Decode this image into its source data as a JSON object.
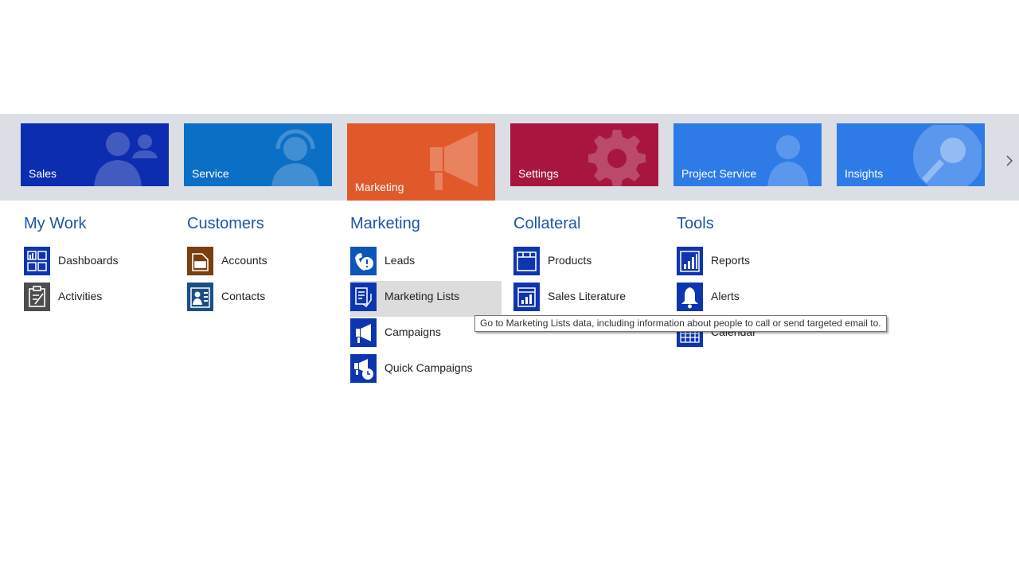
{
  "tiles": [
    {
      "label": "Sales",
      "color": "#0d2db0",
      "icon": "people-icon"
    },
    {
      "label": "Service",
      "color": "#0c6fc6",
      "icon": "headset-person-icon"
    },
    {
      "label": "Marketing",
      "color": "#e1582a",
      "icon": "megaphone-icon",
      "active": true
    },
    {
      "label": "Settings",
      "color": "#a8163f",
      "icon": "gear-icon"
    },
    {
      "label": "Project Service",
      "color": "#2e7be8",
      "icon": "person-icon"
    },
    {
      "label": "Insights",
      "color": "#2e7be8",
      "icon": "magnifier-icon"
    }
  ],
  "columns": [
    {
      "title": "My Work",
      "items": [
        {
          "label": "Dashboards",
          "icon": "dashboard-icon"
        },
        {
          "label": "Activities",
          "icon": "clipboard-icon"
        }
      ]
    },
    {
      "title": "Customers",
      "items": [
        {
          "label": "Accounts",
          "icon": "account-icon"
        },
        {
          "label": "Contacts",
          "icon": "contact-card-icon"
        }
      ]
    },
    {
      "title": "Marketing",
      "items": [
        {
          "label": "Leads",
          "icon": "phone-alert-icon"
        },
        {
          "label": "Marketing Lists",
          "icon": "list-icon",
          "hover": true
        },
        {
          "label": "Campaigns",
          "icon": "megaphone-icon"
        },
        {
          "label": "Quick Campaigns",
          "icon": "quick-campaign-icon"
        }
      ]
    },
    {
      "title": "Collateral",
      "items": [
        {
          "label": "Products",
          "icon": "box-icon"
        },
        {
          "label": "Sales Literature",
          "icon": "document-chart-icon"
        }
      ]
    },
    {
      "title": "Tools",
      "items": [
        {
          "label": "Reports",
          "icon": "report-icon"
        },
        {
          "label": "Alerts",
          "icon": "bell-icon"
        },
        {
          "label": "Calendar",
          "icon": "calendar-icon"
        }
      ]
    }
  ],
  "tooltip": "Go to Marketing Lists data, including information about people to call or send targeted email to.",
  "colors": {
    "heading": "#1e55a8",
    "icon_bg": "#0d35b0",
    "strip_bg": "#dcdee6",
    "hover_bg": "#dcdcdc"
  }
}
